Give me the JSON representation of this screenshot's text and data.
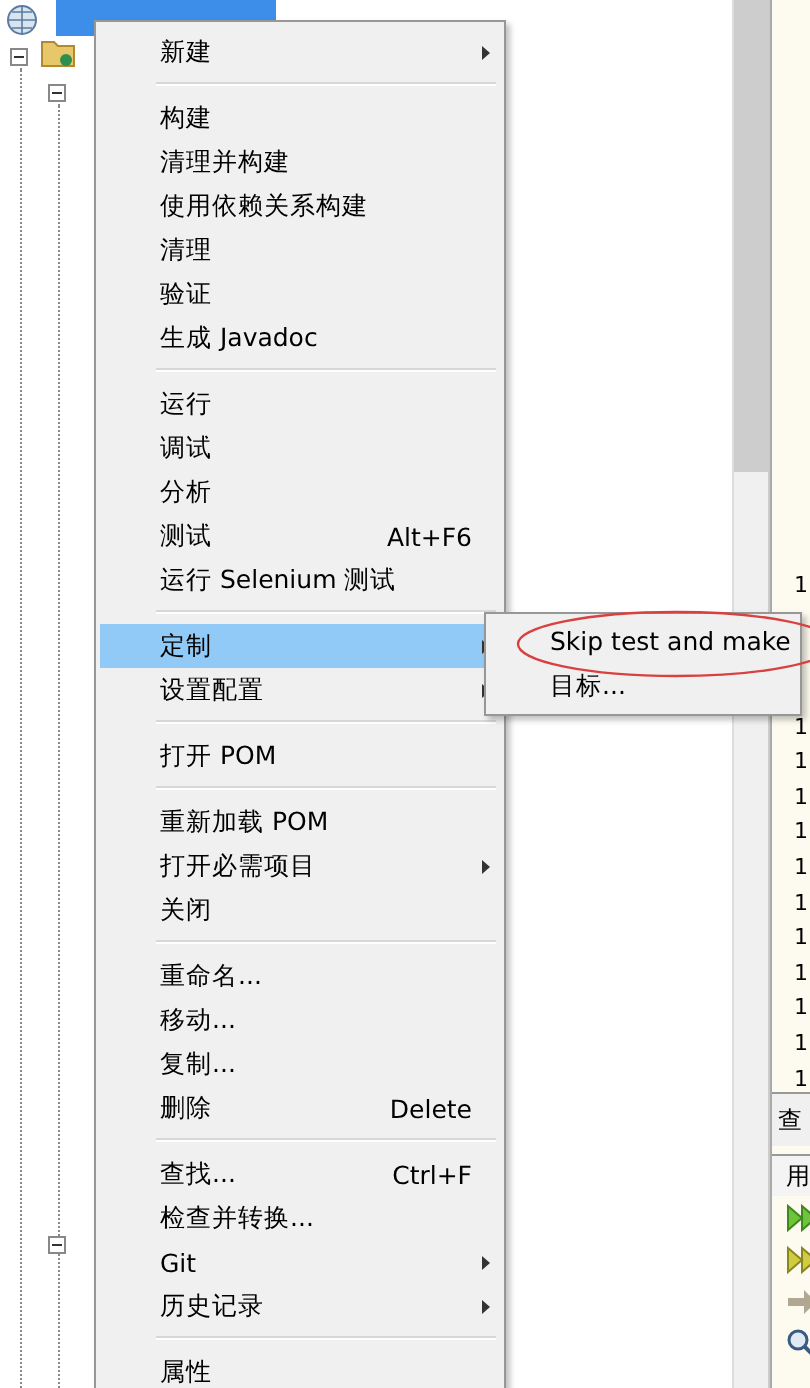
{
  "tree": {
    "root_selected": true
  },
  "context_menu": {
    "items": [
      {
        "kind": "item",
        "label": "新建",
        "submenu": true,
        "selected": false
      },
      {
        "kind": "separator"
      },
      {
        "kind": "item",
        "label": "构建",
        "submenu": false,
        "selected": false
      },
      {
        "kind": "item",
        "label": "清理并构建",
        "submenu": false,
        "selected": false
      },
      {
        "kind": "item",
        "label": "使用依赖关系构建",
        "submenu": false,
        "selected": false
      },
      {
        "kind": "item",
        "label": "清理",
        "submenu": false,
        "selected": false
      },
      {
        "kind": "item",
        "label": "验证",
        "submenu": false,
        "selected": false
      },
      {
        "kind": "item",
        "label": "生成 Javadoc",
        "submenu": false,
        "selected": false
      },
      {
        "kind": "separator"
      },
      {
        "kind": "item",
        "label": "运行",
        "submenu": false,
        "selected": false
      },
      {
        "kind": "item",
        "label": "调试",
        "submenu": false,
        "selected": false
      },
      {
        "kind": "item",
        "label": "分析",
        "submenu": false,
        "selected": false
      },
      {
        "kind": "item",
        "label": "测试",
        "shortcut": "Alt+F6",
        "submenu": false,
        "selected": false
      },
      {
        "kind": "item",
        "label": "运行 Selenium 测试",
        "submenu": false,
        "selected": false
      },
      {
        "kind": "separator"
      },
      {
        "kind": "item",
        "label": "定制",
        "submenu": true,
        "selected": true
      },
      {
        "kind": "item",
        "label": "设置配置",
        "submenu": true,
        "selected": false
      },
      {
        "kind": "separator"
      },
      {
        "kind": "item",
        "label": "打开 POM",
        "submenu": false,
        "selected": false
      },
      {
        "kind": "separator"
      },
      {
        "kind": "item",
        "label": "重新加载 POM",
        "submenu": false,
        "selected": false
      },
      {
        "kind": "item",
        "label": "打开必需项目",
        "submenu": true,
        "selected": false
      },
      {
        "kind": "item",
        "label": "关闭",
        "submenu": false,
        "selected": false
      },
      {
        "kind": "separator"
      },
      {
        "kind": "item",
        "label": "重命名...",
        "submenu": false,
        "selected": false
      },
      {
        "kind": "item",
        "label": "移动...",
        "submenu": false,
        "selected": false
      },
      {
        "kind": "item",
        "label": "复制...",
        "submenu": false,
        "selected": false
      },
      {
        "kind": "item",
        "label": "删除",
        "shortcut": "Delete",
        "submenu": false,
        "selected": false
      },
      {
        "kind": "separator"
      },
      {
        "kind": "item",
        "label": "查找...",
        "shortcut": "Ctrl+F",
        "submenu": false,
        "selected": false
      },
      {
        "kind": "item",
        "label": "检查并转换...",
        "submenu": false,
        "selected": false
      },
      {
        "kind": "item",
        "label": "Git",
        "submenu": true,
        "selected": false
      },
      {
        "kind": "item",
        "label": "历史记录",
        "submenu": true,
        "selected": false
      },
      {
        "kind": "separator"
      },
      {
        "kind": "item",
        "label": "属性",
        "submenu": false,
        "selected": false
      }
    ]
  },
  "submenu": {
    "items": [
      {
        "label": "Skip test and make",
        "circled": true
      },
      {
        "label": "目标...",
        "circled": false
      }
    ]
  },
  "output_panel": {
    "line_numbers": [
      "1",
      "1",
      "1",
      "1",
      "1",
      "1",
      "1",
      "1",
      "1",
      "1",
      "1",
      "1"
    ],
    "find_tab": "查",
    "usage_header": "用"
  }
}
